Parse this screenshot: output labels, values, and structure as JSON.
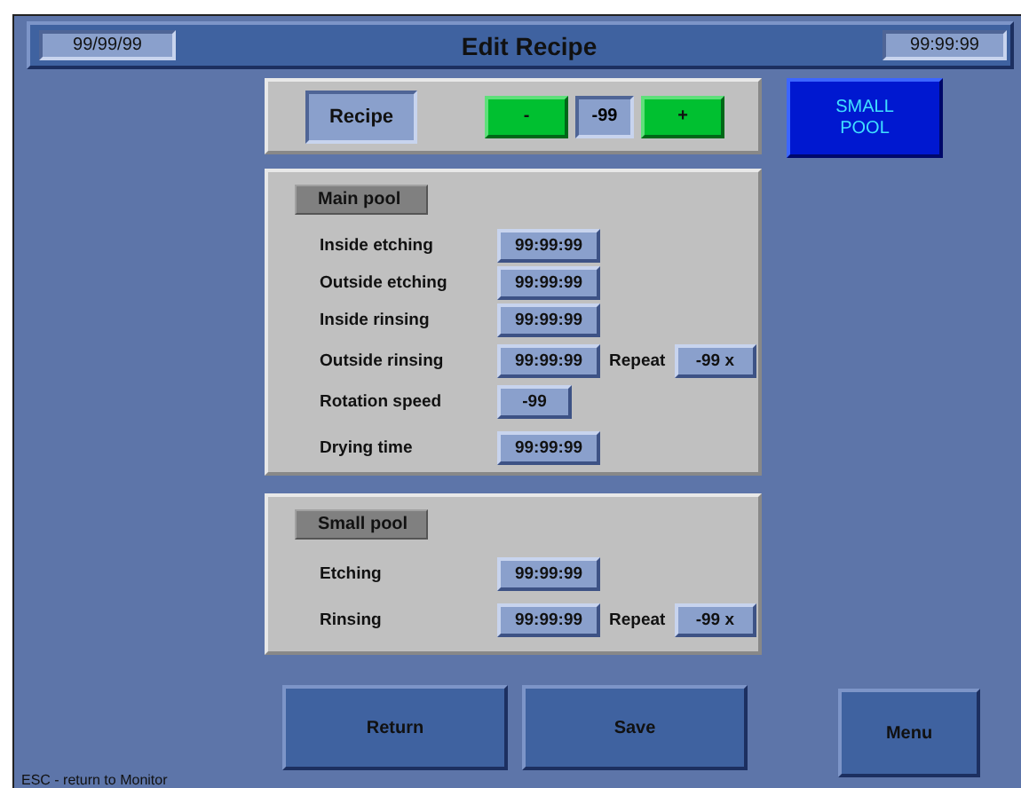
{
  "header": {
    "date": "99/99/99",
    "title": "Edit Recipe",
    "time": "99:99:99"
  },
  "recipe": {
    "label": "Recipe",
    "decrement": "-",
    "value": "-99",
    "increment": "+"
  },
  "pool_button": "SMALL\nPOOL",
  "sections": [
    {
      "title": "Main pool",
      "rows": [
        {
          "label": "Inside etching",
          "value": "99:99:99"
        },
        {
          "label": "Outside etching",
          "value": "99:99:99"
        },
        {
          "label": "Inside rinsing",
          "value": "99:99:99"
        },
        {
          "label": "Outside rinsing",
          "value": "99:99:99",
          "repeat": {
            "label": "Repeat",
            "value": "-99 x"
          }
        },
        {
          "label": "Rotation speed",
          "value": "-99"
        },
        {
          "label": "Drying time",
          "value": "99:99:99"
        }
      ]
    },
    {
      "title": "Small pool",
      "rows": [
        {
          "label": "Etching",
          "value": "99:99:99"
        },
        {
          "label": "Rinsing",
          "value": "99:99:99",
          "repeat": {
            "label": "Repeat",
            "value": "-99 x"
          }
        }
      ]
    }
  ],
  "buttons": [
    "Return",
    "Save"
  ],
  "menu_button": "Menu",
  "status_bar": "ESC - return to Monitor"
}
